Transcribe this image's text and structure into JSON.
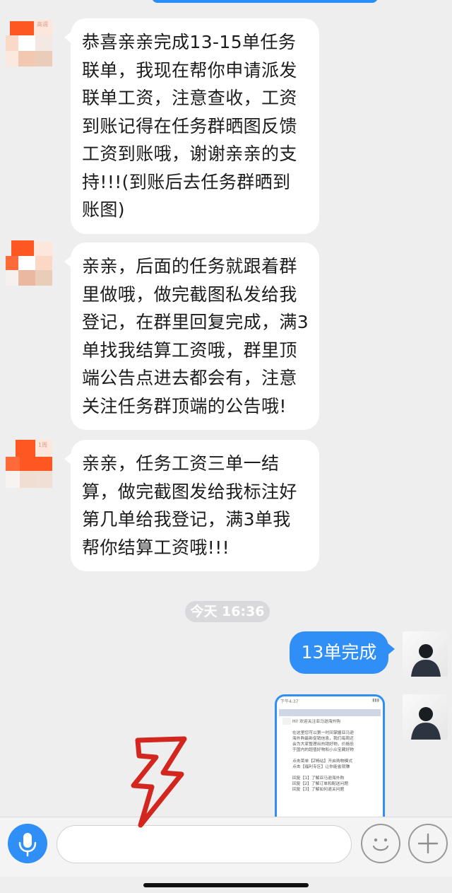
{
  "messages": [
    {
      "sender": "contact",
      "lines": [
        "恭喜亲亲完成13-15单任务",
        "联单，我现在帮你申请派发",
        "联单工资，注意查收，工资",
        "到账记得在任务群晒图反馈",
        "工资到账哦，谢谢亲亲的支",
        "持!!!(到账后去任务群晒到",
        "账图)"
      ],
      "avatar_label": "高週"
    },
    {
      "sender": "contact",
      "lines": [
        "亲亲，后面的任务就跟着群",
        "里做哦，做完截图私发给我",
        "登记，在群里回复完成，满3",
        "单找我结算工资哦，群里顶",
        "端公告点进去都会有，注意",
        "关注任务群顶端的公告哦!"
      ]
    },
    {
      "sender": "contact",
      "lines": [
        "亲亲，任务工资三单一结",
        "算，做完截图发给我标注好",
        "第几单给我登记，满3单我",
        "帮你结算工资哦!!!"
      ],
      "avatar_label": "1周"
    }
  ],
  "timestamp": "今天 16:36",
  "outgoing": {
    "text": "13单完成"
  },
  "screenshot_preview": {
    "status_time": "下午4:37",
    "lines": [
      "Hi! 欢迎关注亚马逊海外购",
      "",
      "在这里您可以第一时间掌握亚马逊",
      "海外购最新促销信息，我们每周还",
      "会为大家整理出热销好物，价格低",
      "于国内的超值好物和小众宝藏好物",
      "",
      "点击菜单【Z畅站】开启购物模式",
      "点击【福利专区】让你能省就赚",
      "",
      "回复【1】了解亚马逊海外购",
      "回复【2】了解订单和配送问题",
      "回复【3】了解如何退关问题"
    ]
  },
  "input_bar": {
    "placeholder": ""
  },
  "colors": {
    "accent": "#2f8ff7",
    "background": "#eeeeef",
    "arrow": "#d2261f"
  },
  "icons": [
    "microphone-icon",
    "emoji-icon",
    "plus-icon",
    "arrow-annotation-icon"
  ]
}
